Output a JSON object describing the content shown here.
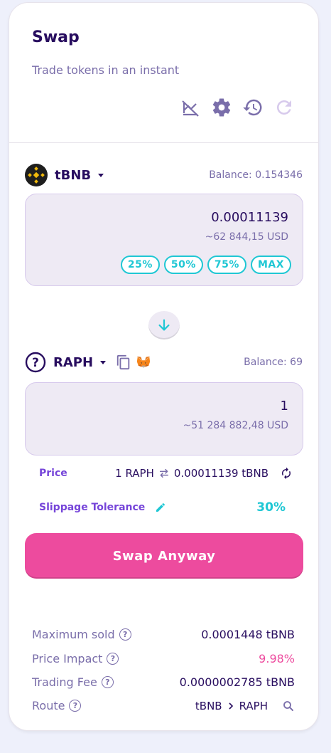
{
  "header": {
    "title": "Swap",
    "subtitle": "Trade tokens in an instant"
  },
  "from": {
    "token": "tBNB",
    "balance": "Balance: 0.154346",
    "amount": "0.00011139",
    "usd": "~62 844,15 USD",
    "percent_buttons": [
      "25%",
      "50%",
      "75%",
      "MAX"
    ]
  },
  "to": {
    "token": "RAPH",
    "balance": "Balance: 69",
    "amount": "1",
    "usd": "~51 284 882,48 USD"
  },
  "price": {
    "label": "Price",
    "base": "1 RAPH",
    "quote": "0.00011139 tBNB"
  },
  "slippage": {
    "label": "Slippage Tolerance",
    "value": "30%"
  },
  "swap_button": "Swap Anyway",
  "details": {
    "max_sold_label": "Maximum sold",
    "max_sold_value": "0.0001448 tBNB",
    "price_impact_label": "Price Impact",
    "price_impact_value": "9.98%",
    "trading_fee_label": "Trading Fee",
    "trading_fee_value": "0.0000002785 tBNB",
    "route_label": "Route",
    "route_from": "tBNB",
    "route_to": "RAPH"
  },
  "colors": {
    "primary": "#1fc7d4",
    "secondary": "#7645d9",
    "pink": "#ed4b9e",
    "text": "#280d5f",
    "text_subtle": "#7a6eaa"
  }
}
